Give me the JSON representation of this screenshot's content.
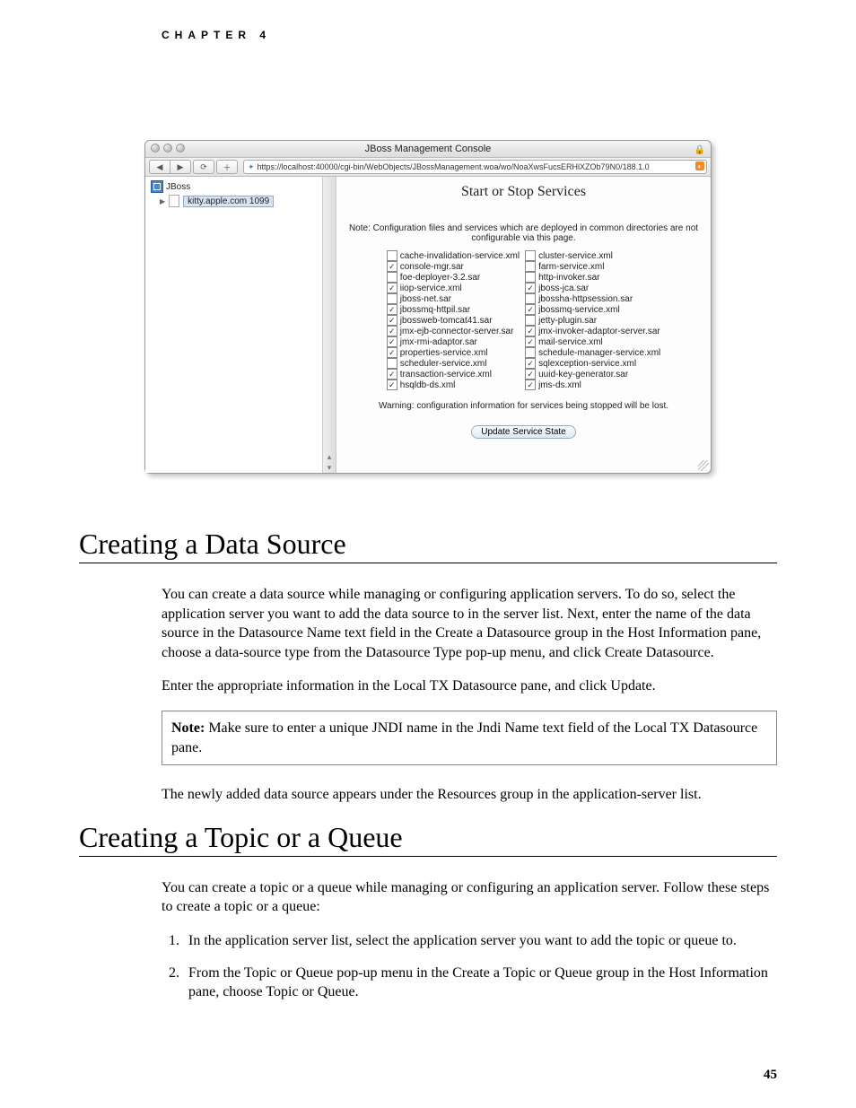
{
  "running_head": "CHAPTER 4",
  "page_number": "45",
  "screenshot": {
    "window_title": "JBoss Management Console",
    "url": "https://localhost:40000/cgi-bin/WebObjects/JBossManagement.woa/wo/NoaXwsFucsERHlXZOb79N0/188.1.0",
    "tree_root": "JBoss",
    "tree_node": "kitty.apple.com 1099",
    "content_title": "Start or Stop Services",
    "config_note": "Note: Configuration files and services which are deployed in common directories are not configurable via this page.",
    "services_left": [
      {
        "c": false,
        "n": "cache-invalidation-service.xml"
      },
      {
        "c": true,
        "n": "console-mgr.sar"
      },
      {
        "c": false,
        "n": "foe-deployer-3.2.sar"
      },
      {
        "c": true,
        "n": "iiop-service.xml"
      },
      {
        "c": false,
        "n": "jboss-net.sar"
      },
      {
        "c": true,
        "n": "jbossmq-httpil.sar"
      },
      {
        "c": true,
        "n": "jbossweb-tomcat41.sar"
      },
      {
        "c": true,
        "n": "jmx-ejb-connector-server.sar"
      },
      {
        "c": true,
        "n": "jmx-rmi-adaptor.sar"
      },
      {
        "c": true,
        "n": "properties-service.xml"
      },
      {
        "c": false,
        "n": "scheduler-service.xml"
      },
      {
        "c": true,
        "n": "transaction-service.xml"
      },
      {
        "c": true,
        "n": "hsqldb-ds.xml"
      }
    ],
    "services_right": [
      {
        "c": false,
        "n": "cluster-service.xml"
      },
      {
        "c": false,
        "n": "farm-service.xml"
      },
      {
        "c": false,
        "n": "http-invoker.sar"
      },
      {
        "c": true,
        "n": "jboss-jca.sar"
      },
      {
        "c": false,
        "n": "jbossha-httpsession.sar"
      },
      {
        "c": true,
        "n": "jbossmq-service.xml"
      },
      {
        "c": false,
        "n": "jetty-plugin.sar"
      },
      {
        "c": true,
        "n": "jmx-invoker-adaptor-server.sar"
      },
      {
        "c": true,
        "n": "mail-service.xml"
      },
      {
        "c": false,
        "n": "schedule-manager-service.xml"
      },
      {
        "c": true,
        "n": "sqlexception-service.xml"
      },
      {
        "c": true,
        "n": "uuid-key-generator.sar"
      },
      {
        "c": true,
        "n": "jms-ds.xml"
      }
    ],
    "warning": "Warning: configuration information for services being stopped will be lost.",
    "button": "Update Service State"
  },
  "sections": {
    "ds_title": "Creating a Data Source",
    "ds_p1": "You can create a data source while managing or configuring application servers. To do so, select the application server you want to add the data source to in the server list. Next, enter the name of the data source in the Datasource Name text field in the Create a Datasource group in the Host Information pane, choose a data-source type from the Datasource Type pop-up menu, and click Create Datasource.",
    "ds_p2": "Enter the appropriate information in the Local TX Datasource pane, and click Update.",
    "ds_note_label": "Note:",
    "ds_note_body": " Make sure to enter a unique JNDI name in the Jndi Name text field of the Local TX Datasource pane.",
    "ds_p3": "The newly added data source appears under the Resources group in the application-server list.",
    "tq_title": "Creating a Topic or a Queue",
    "tq_p1": "You can create a topic or a queue while managing or configuring an application server. Follow these steps to create a topic or a queue:",
    "tq_step1": "In the application server list, select the application server you want to add the topic or queue to.",
    "tq_step2": "From the Topic or Queue pop-up menu in the Create a Topic or Queue group in the Host Information pane, choose Topic or Queue."
  }
}
